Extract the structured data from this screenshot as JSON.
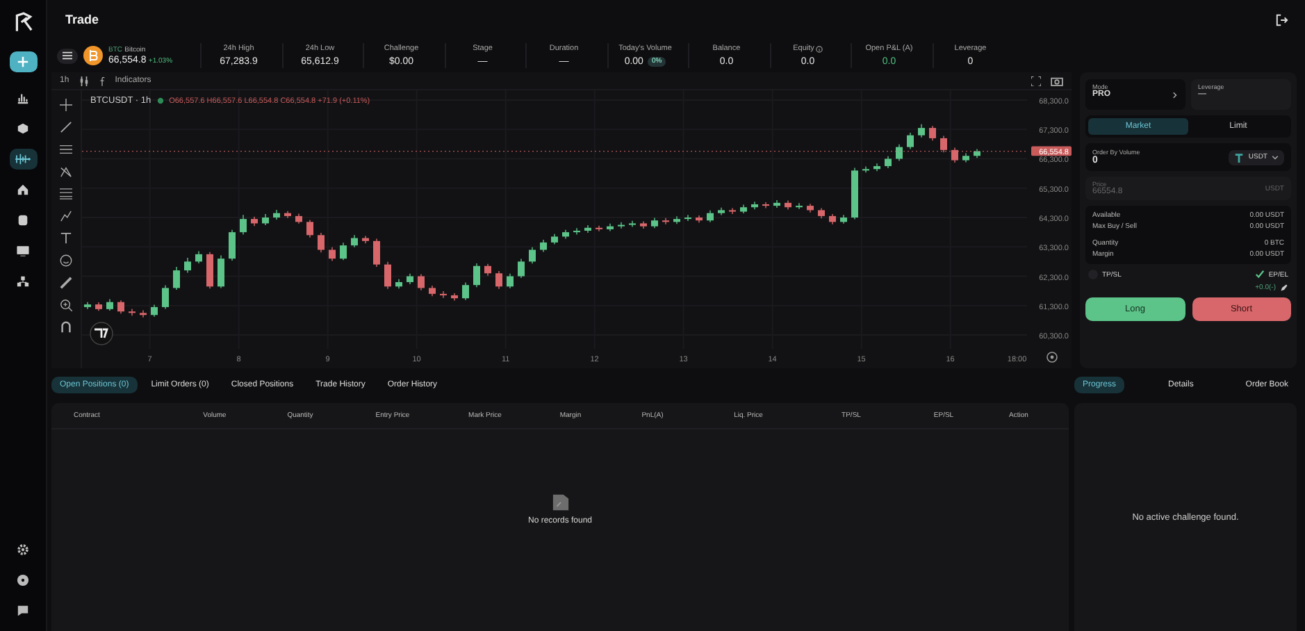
{
  "app": {
    "title": "Trade"
  },
  "sidebar": {
    "items": [
      {
        "kind": "add",
        "selected": false
      },
      {
        "kind": "chart",
        "selected": false
      },
      {
        "kind": "cube",
        "selected": false
      },
      {
        "kind": "trade",
        "selected": true
      },
      {
        "kind": "home",
        "selected": false
      },
      {
        "kind": "database",
        "selected": false
      },
      {
        "kind": "monitor",
        "selected": false
      },
      {
        "kind": "network",
        "selected": false
      }
    ],
    "bottom": [
      {
        "kind": "settings"
      },
      {
        "kind": "help"
      },
      {
        "kind": "chat"
      }
    ]
  },
  "ticker": {
    "symbol": "BTC",
    "name": "Bitcoin",
    "price": "66,554.8",
    "change": "+1.03%"
  },
  "stats": [
    {
      "kind": "plain",
      "label": "24h High",
      "value": "67,283.9"
    },
    {
      "kind": "plain",
      "label": "24h Low",
      "value": "65,612.9"
    },
    {
      "kind": "plain",
      "label": "Challenge",
      "value": "$0.00"
    },
    {
      "kind": "plain",
      "label": "Stage",
      "value": "—"
    },
    {
      "kind": "plain",
      "label": "Duration",
      "value": "—"
    },
    {
      "kind": "volume",
      "label": "Today's Volume",
      "value": "0.00",
      "badge": "0%"
    },
    {
      "kind": "plain",
      "label": "Balance",
      "value": "0.0"
    },
    {
      "kind": "info",
      "label": "Equity",
      "value": "0.0"
    },
    {
      "kind": "pnl",
      "label": "Open P&L (A)",
      "value": "0.0"
    },
    {
      "kind": "plain",
      "label": "Leverage",
      "value": "0"
    }
  ],
  "chart": {
    "interval": "1h",
    "indicators": "Indicators",
    "legend_symbol": "BTCUSDT · 1h",
    "ohlc": "O66,557.6 H66,557.6 L66,554.8 C66,554.8 +71.9 (+0.11%)",
    "last_price": "66,554.8",
    "hour_label": "18:00",
    "chart_data": {
      "type": "candlestick",
      "grid": true,
      "ref_lines": [
        {
          "axis": "y",
          "value": 66554.8,
          "color": "#d8676b"
        }
      ],
      "xlim": [
        6.2375,
        16.8625
      ],
      "ylim": [
        59827,
        68631
      ],
      "x": [
        6.3,
        6.425,
        6.55,
        6.675,
        6.8,
        6.925,
        7.05,
        7.175,
        7.3,
        7.425,
        7.55,
        7.675,
        7.8,
        7.925,
        8.05,
        8.175,
        8.3,
        8.425,
        8.55,
        8.675,
        8.8,
        8.925,
        9.05,
        9.175,
        9.3,
        9.425,
        9.55,
        9.675,
        9.8,
        9.925,
        10.05,
        10.175,
        10.3,
        10.425,
        10.55,
        10.675,
        10.8,
        10.925,
        11.05,
        11.175,
        11.3,
        11.425,
        11.55,
        11.675,
        11.8,
        11.925,
        12.05,
        12.175,
        12.3,
        12.425,
        12.55,
        12.675,
        12.8,
        12.925,
        13.05,
        13.175,
        13.3,
        13.425,
        13.55,
        13.675,
        13.8,
        13.925,
        14.05,
        14.175,
        14.3,
        14.425,
        14.55,
        14.675,
        14.8,
        14.925,
        15.05,
        15.175,
        15.3,
        15.425,
        15.55,
        15.675,
        15.8,
        15.925,
        16.05,
        16.175,
        16.3
      ],
      "ohlc": [
        [
          61250,
          61420,
          61180,
          61340
        ],
        [
          61340,
          61410,
          61120,
          61180
        ],
        [
          61180,
          61520,
          61130,
          61420
        ],
        [
          61420,
          61480,
          61030,
          61100
        ],
        [
          61100,
          61190,
          60960,
          61050
        ],
        [
          61050,
          61140,
          60900,
          60980
        ],
        [
          60980,
          61330,
          60920,
          61250
        ],
        [
          61250,
          61990,
          61190,
          61900
        ],
        [
          61900,
          62620,
          61840,
          62500
        ],
        [
          62500,
          62930,
          62420,
          62800
        ],
        [
          62800,
          63150,
          62740,
          63050
        ],
        [
          63050,
          63120,
          61880,
          61950
        ],
        [
          61950,
          63010,
          61900,
          62900
        ],
        [
          62900,
          63880,
          62830,
          63800
        ],
        [
          63800,
          64390,
          63720,
          64250
        ],
        [
          64250,
          64330,
          64010,
          64100
        ],
        [
          64100,
          64420,
          64040,
          64300
        ],
        [
          64300,
          64560,
          64230,
          64450
        ],
        [
          64450,
          64520,
          64280,
          64350
        ],
        [
          64350,
          64430,
          64090,
          64150
        ],
        [
          64150,
          64220,
          63620,
          63700
        ],
        [
          63700,
          63780,
          63110,
          63200
        ],
        [
          63200,
          63290,
          62820,
          62900
        ],
        [
          62900,
          63440,
          62850,
          63350
        ],
        [
          63350,
          63700,
          63290,
          63600
        ],
        [
          63600,
          63670,
          63420,
          63500
        ],
        [
          63500,
          63580,
          62620,
          62700
        ],
        [
          62700,
          62790,
          61870,
          61950
        ],
        [
          61950,
          62200,
          61880,
          62100
        ],
        [
          62100,
          62390,
          62030,
          62300
        ],
        [
          62300,
          62370,
          61820,
          61900
        ],
        [
          61900,
          61980,
          61620,
          61700
        ],
        [
          61700,
          61790,
          61560,
          61650
        ],
        [
          61650,
          61720,
          61470,
          61550
        ],
        [
          61550,
          62090,
          61490,
          62000
        ],
        [
          62000,
          62740,
          61930,
          62650
        ],
        [
          62650,
          62720,
          62320,
          62400
        ],
        [
          62400,
          62480,
          61870,
          61950
        ],
        [
          61950,
          62390,
          61890,
          62300
        ],
        [
          62300,
          62890,
          62240,
          62800
        ],
        [
          62800,
          63290,
          62730,
          63200
        ],
        [
          63200,
          63540,
          63130,
          63450
        ],
        [
          63450,
          63740,
          63390,
          63650
        ],
        [
          63650,
          63880,
          63580,
          63800
        ],
        [
          63800,
          63940,
          63720,
          63850
        ],
        [
          63850,
          64040,
          63780,
          63950
        ],
        [
          63950,
          64020,
          63830,
          63900
        ],
        [
          63900,
          64090,
          63840,
          64000
        ],
        [
          64000,
          64140,
          63930,
          64050
        ],
        [
          64050,
          64190,
          63980,
          64100
        ],
        [
          64100,
          64170,
          63920,
          64000
        ],
        [
          64000,
          64290,
          63940,
          64200
        ],
        [
          64200,
          64280,
          64070,
          64150
        ],
        [
          64150,
          64340,
          64080,
          64250
        ],
        [
          64250,
          64390,
          64180,
          64300
        ],
        [
          64300,
          64370,
          64120,
          64200
        ],
        [
          64200,
          64540,
          64140,
          64450
        ],
        [
          64450,
          64640,
          64380,
          64550
        ],
        [
          64550,
          64620,
          64420,
          64500
        ],
        [
          64500,
          64740,
          64440,
          64650
        ],
        [
          64650,
          64840,
          64580,
          64750
        ],
        [
          64750,
          64820,
          64620,
          64700
        ],
        [
          64700,
          64890,
          64630,
          64800
        ],
        [
          64800,
          64880,
          64570,
          64650
        ],
        [
          64650,
          64790,
          64590,
          64700
        ],
        [
          64700,
          64770,
          64470,
          64550
        ],
        [
          64550,
          64620,
          64270,
          64350
        ],
        [
          64350,
          64420,
          64070,
          64150
        ],
        [
          64150,
          64390,
          64090,
          64300
        ],
        [
          64300,
          65990,
          64240,
          65900
        ],
        [
          65900,
          66040,
          65830,
          65950
        ],
        [
          65950,
          66140,
          65880,
          66050
        ],
        [
          66050,
          66390,
          65980,
          66300
        ],
        [
          66300,
          66790,
          66230,
          66700
        ],
        [
          66700,
          67190,
          66630,
          67100
        ],
        [
          67100,
          67480,
          67030,
          67350
        ],
        [
          67350,
          67420,
          66920,
          67000
        ],
        [
          67000,
          67080,
          66520,
          66600
        ],
        [
          66600,
          66680,
          66170,
          66250
        ],
        [
          66250,
          66490,
          66180,
          66400
        ],
        [
          66400,
          66630,
          66330,
          66554.8
        ]
      ],
      "yticks": [
        {
          "value": 68300,
          "label": "68,300.0"
        },
        {
          "value": 67300,
          "label": "67,300.0"
        },
        {
          "value": 66300,
          "label": "66,300.0"
        },
        {
          "value": 65300,
          "label": "65,300.0"
        },
        {
          "value": 64300,
          "label": "64,300.0"
        },
        {
          "value": 63300,
          "label": "63,300.0"
        },
        {
          "value": 62300,
          "label": "62,300.0"
        },
        {
          "value": 61300,
          "label": "61,300.0"
        },
        {
          "value": 60300,
          "label": "60,300.0"
        }
      ],
      "xticks": [
        7,
        8,
        9,
        10,
        11,
        12,
        13,
        14,
        15,
        16
      ]
    }
  },
  "order_panel": {
    "mode": {
      "label": "Mode",
      "value": "PRO"
    },
    "leverage": {
      "label": "Leverage",
      "value": "—"
    },
    "order_types": [
      {
        "label": "Market",
        "selected": true
      },
      {
        "label": "Limit",
        "selected": false
      }
    ],
    "volume": {
      "label": "Order By Volume",
      "value": "0",
      "currency": "USDT"
    },
    "price": {
      "label": "Price",
      "value": "66554.8",
      "unit": "USDT",
      "disabled": true
    },
    "summary": [
      {
        "label": "Available",
        "value": "0.00 USDT"
      },
      {
        "label": "Max Buy / Sell",
        "value": "0.00 USDT"
      },
      {
        "label": "Quantity",
        "value": "0 BTC"
      },
      {
        "label": "Margin",
        "value": "0.00 USDT"
      }
    ],
    "tpsl": {
      "label": "TP/SL",
      "checked": false
    },
    "epel": {
      "label": "EP/EL",
      "checked": true,
      "value": "+0.0(-)"
    },
    "long": "Long",
    "short": "Short"
  },
  "positions": {
    "tabs": [
      {
        "label": "Open Positions (0)",
        "selected": true
      },
      {
        "label": "Limit Orders (0)",
        "selected": false
      },
      {
        "label": "Closed Positions",
        "selected": false
      },
      {
        "label": "Trade History",
        "selected": false
      },
      {
        "label": "Order History",
        "selected": false
      }
    ],
    "columns": [
      "Contract",
      "Volume",
      "Quantity",
      "Entry Price",
      "Mark Price",
      "Margin",
      "PnL(A)",
      "Liq. Price",
      "TP/SL",
      "EP/SL",
      "Action"
    ],
    "empty": "No records found"
  },
  "challenge": {
    "tabs": [
      {
        "label": "Progress",
        "selected": true
      },
      {
        "label": "Details",
        "selected": false
      },
      {
        "label": "Order Book",
        "selected": false
      }
    ],
    "empty": "No active challenge found."
  }
}
